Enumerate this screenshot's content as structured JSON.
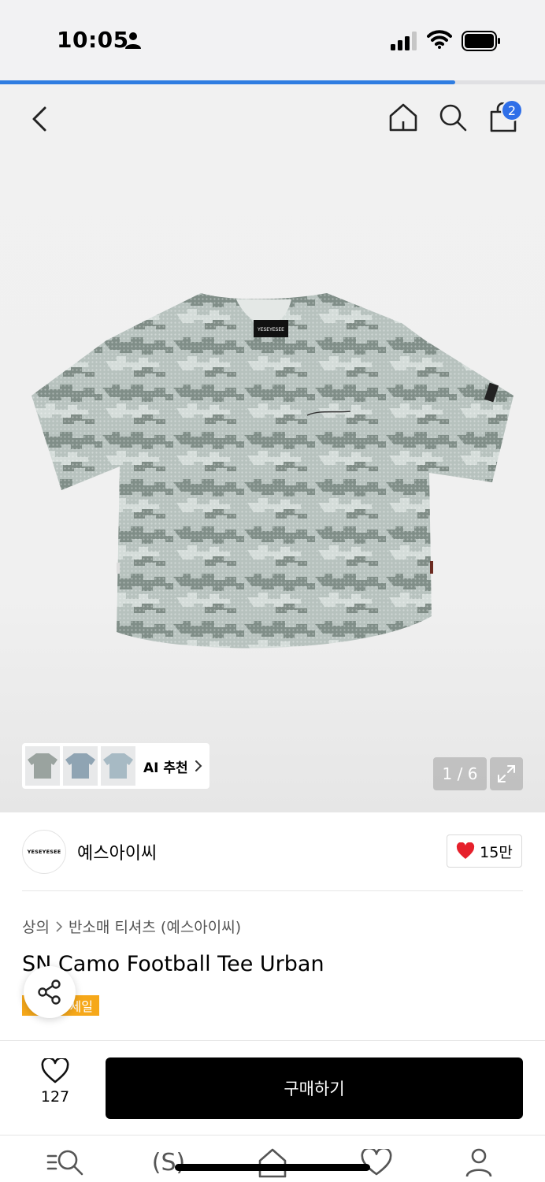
{
  "status_bar": {
    "time": "10:05"
  },
  "page_progress": 0.835,
  "header": {
    "cart_count": "2"
  },
  "gallery": {
    "ai_label": "AI 추천",
    "page_counter": "1 / 6",
    "shirt_logo": "YESEYESEE"
  },
  "brand": {
    "logo_text": "YESEYESEE",
    "name": "예스아이씨",
    "like_count": "15만"
  },
  "product": {
    "breadcrumb": [
      "상의",
      "반소매 티셔츠 (예스아이씨)"
    ],
    "title": "SN Camo Football Tee Urban",
    "badge": "세일"
  },
  "purchase": {
    "wish_count": "127",
    "buy_label": "구매하기"
  },
  "tabs": {
    "snap_label": "(S)"
  },
  "colors": {
    "accent": "#2f6fe8",
    "sale": "#f6a81a",
    "heart": "#e6202b"
  }
}
